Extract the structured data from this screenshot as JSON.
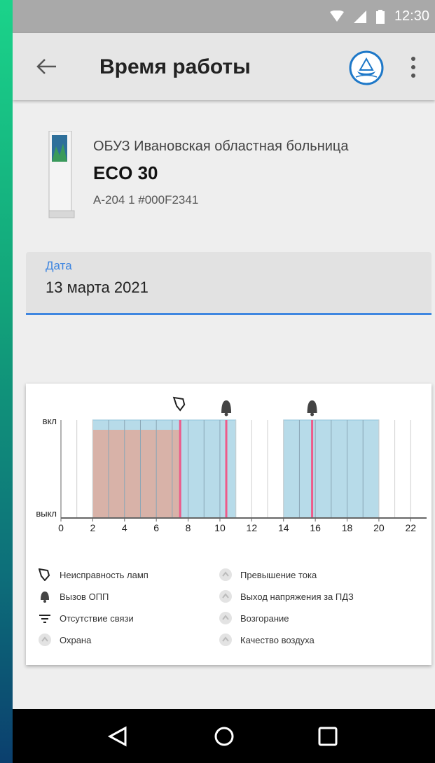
{
  "status_bar": {
    "time": "12:30"
  },
  "app_bar": {
    "title": "Время работы"
  },
  "device": {
    "organization": "ОБУЗ Ивановская областная больница",
    "model": "ECO 30",
    "serial": "A-204 1 #000F2341"
  },
  "date_field": {
    "label": "Дата",
    "value": "13 марта 2021"
  },
  "chart_data": {
    "type": "area",
    "y_labels": [
      "вкл",
      "выкл"
    ],
    "x_ticks": [
      0,
      2,
      4,
      6,
      8,
      10,
      12,
      14,
      16,
      18,
      20,
      22
    ],
    "xlim": [
      0,
      23
    ],
    "on_intervals": [
      [
        2,
        11
      ],
      [
        14,
        20
      ]
    ],
    "lamp_fault_area": [
      2,
      7.5
    ],
    "events": [
      {
        "type": "lamp",
        "x": 7.5
      },
      {
        "type": "bell",
        "x": 10.4
      },
      {
        "type": "bell",
        "x": 15.8
      }
    ],
    "colors": {
      "on": "#b7dbe9",
      "fault": "#d8b2a8",
      "event": "#ee5a8a"
    }
  },
  "legend": {
    "left": [
      {
        "icon": "lamp-icon",
        "label": "Неисправность ламп"
      },
      {
        "icon": "bell-icon",
        "label": "Вызов ОПП"
      },
      {
        "icon": "no-connection-icon",
        "label": "Отсутствие связи"
      },
      {
        "icon": "guard-icon",
        "label": "Охрана"
      }
    ],
    "right": [
      {
        "icon": "overcurrent-icon",
        "label": "Превышение тока"
      },
      {
        "icon": "voltage-icon",
        "label": "Выход напряжения за ПДЗ"
      },
      {
        "icon": "fire-icon",
        "label": "Возгорание"
      },
      {
        "icon": "air-quality-icon",
        "label": "Качество воздуха"
      }
    ]
  }
}
